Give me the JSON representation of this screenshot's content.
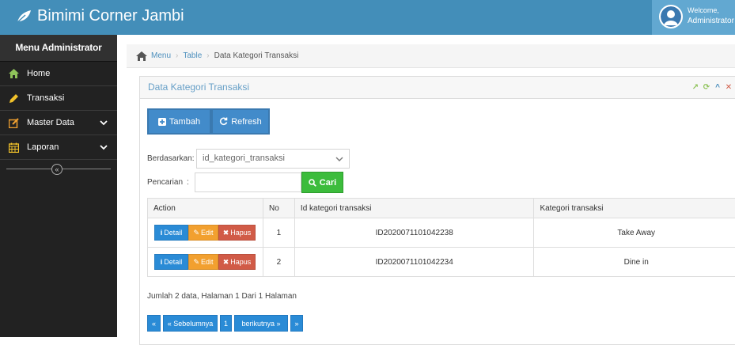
{
  "app": {
    "title": "Bimimi Corner Jambi"
  },
  "user": {
    "welcome": "Welcome,",
    "name": "Administrator"
  },
  "sidebar": {
    "title": "Menu Administrator",
    "items": [
      {
        "label": "Home",
        "icon": "home-icon"
      },
      {
        "label": "Transaksi",
        "icon": "pencil-icon"
      },
      {
        "label": "Master Data",
        "icon": "edit-icon",
        "has_submenu": true
      },
      {
        "label": "Laporan",
        "icon": "calendar-icon",
        "has_submenu": true
      }
    ],
    "collapse_glyph": "«"
  },
  "breadcrumb": {
    "items": [
      "Menu",
      "Table",
      "Data Kategori Transaksi"
    ]
  },
  "panel": {
    "title": "Data Kategori Transaksi",
    "tools": [
      "↗",
      "⟳",
      "^",
      "✕"
    ]
  },
  "toolbar": {
    "tambah_label": "Tambah",
    "refresh_label": "Refresh"
  },
  "search": {
    "by_label": "Berdasarkan:",
    "by_value": "id_kategori_transaksi",
    "query_label": "Pencarian",
    "query_colon": ":",
    "query_value": "",
    "cari_label": "Cari"
  },
  "table": {
    "headers": [
      "Action",
      "No",
      "Id kategori transaksi",
      "Kategori transaksi"
    ],
    "action_labels": {
      "detail": "Detail",
      "edit": "Edit",
      "hapus": "Hapus"
    },
    "rows": [
      {
        "no": "1",
        "id": "ID2020071101042238",
        "kategori": "Take Away"
      },
      {
        "no": "2",
        "id": "ID2020071101042234",
        "kategori": "Dine in"
      }
    ]
  },
  "summary": "Jumlah 2 data, Halaman 1 Dari 1 Halaman",
  "pagination": {
    "first": "«",
    "prev": "« Sebelumnya",
    "page": "1",
    "next": "berikutnya »",
    "last": "»"
  },
  "colors": {
    "navbar": "#438eb9",
    "sidebar": "#222222",
    "primary": "#428bca",
    "success": "#3cbc3c",
    "warning": "#f2a02f",
    "danger": "#d15b47"
  }
}
